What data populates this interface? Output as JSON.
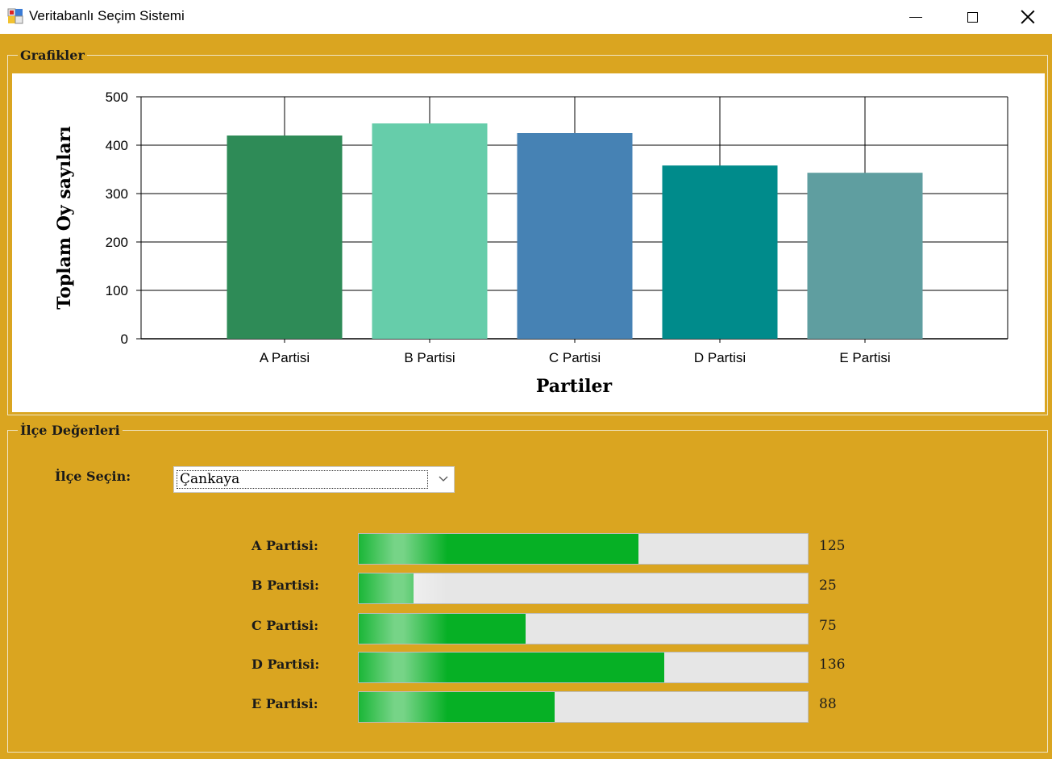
{
  "window": {
    "title": "Veritabanlı Seçim Sistemi"
  },
  "charts_group": {
    "legend": "Grafikler"
  },
  "chart_data": {
    "type": "bar",
    "categories": [
      "A Partisi",
      "B Partisi",
      "C Partisi",
      "D Partisi",
      "E Partisi"
    ],
    "values": [
      420,
      445,
      425,
      358,
      343
    ],
    "colors": [
      "#2E8B57",
      "#66CDAA",
      "#4682B4",
      "#008B8B",
      "#5F9EA0"
    ],
    "xlabel": "Partiler",
    "ylabel": "Toplam Oy sayıları",
    "ylim": [
      0,
      500
    ],
    "yticks": [
      0,
      100,
      200,
      300,
      400,
      500
    ],
    "grid": true
  },
  "district_group": {
    "legend": "İlçe Değerleri",
    "select_label": "İlçe Seçin:",
    "selected_district": "Çankaya",
    "progress_max": 200,
    "parties": [
      {
        "label": "A Partisi:",
        "value": "125",
        "percent": 62.3
      },
      {
        "label": "B Partisi:",
        "value": "25",
        "percent": 12.2
      },
      {
        "label": "C Partisi:",
        "value": "75",
        "percent": 37.2
      },
      {
        "label": "D Partisi:",
        "value": "136",
        "percent": 68
      },
      {
        "label": "E Partisi:",
        "value": "88",
        "percent": 43.6
      }
    ]
  },
  "colors": {
    "background": "#DAA520",
    "progress_fill": "#06B025"
  }
}
